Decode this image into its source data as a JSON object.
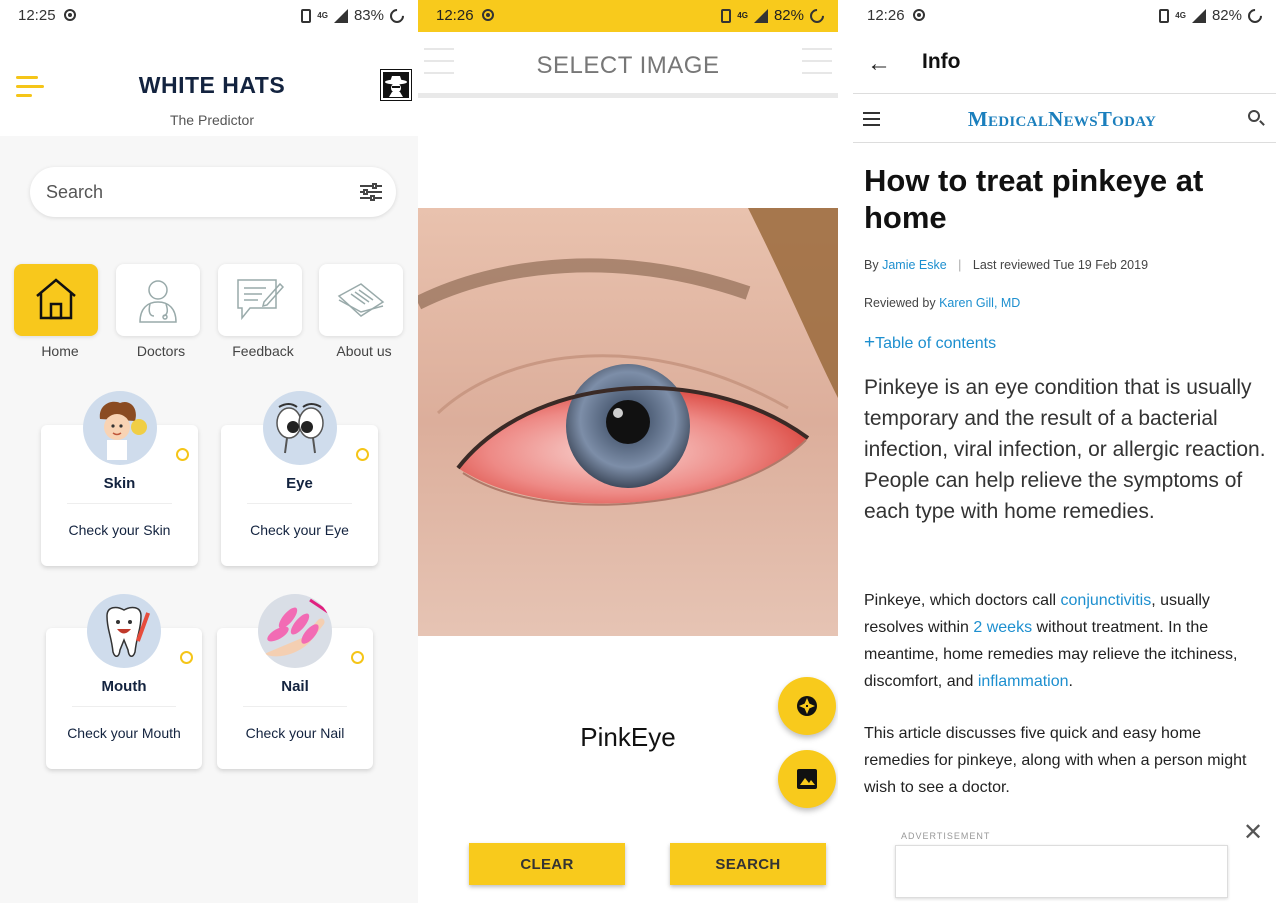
{
  "panel1": {
    "status": {
      "time": "12:25",
      "network": "4G",
      "battery": "83%"
    },
    "app_title": "WHITE HATS",
    "app_subtitle": "The Predictor",
    "search_placeholder": "Search",
    "nav": [
      {
        "label": "Home",
        "icon": "home-icon",
        "active": true
      },
      {
        "label": "Doctors",
        "icon": "doctor-icon",
        "active": false
      },
      {
        "label": "Feedback",
        "icon": "feedback-icon",
        "active": false
      },
      {
        "label": "About us",
        "icon": "about-icon",
        "active": false
      }
    ],
    "cards": [
      {
        "title": "Skin",
        "subtitle": "Check your Skin",
        "icon": "skin-avatar-icon"
      },
      {
        "title": "Eye",
        "subtitle": "Check your Eye",
        "icon": "eye-avatar-icon"
      },
      {
        "title": "Mouth",
        "subtitle": "Check your Mouth",
        "icon": "tooth-avatar-icon"
      },
      {
        "title": "Nail",
        "subtitle": "Check your Nail",
        "icon": "nail-avatar-icon"
      }
    ],
    "accent_color": "#f8c81c",
    "title_color": "#13233f"
  },
  "panel2": {
    "status": {
      "time": "12:26",
      "network": "4G",
      "battery": "82%"
    },
    "title": "SELECT IMAGE",
    "result": "PinkEye",
    "clear_label": "CLEAR",
    "search_label": "SEARCH",
    "fab_camera_icon": "camera-aperture-icon",
    "fab_gallery_icon": "image-gallery-icon"
  },
  "panel3": {
    "status": {
      "time": "12:26",
      "network": "4G",
      "battery": "82%"
    },
    "title": "Info",
    "site_logo": "MedicalNewsToday",
    "headline": "How to treat pinkeye at home",
    "byline_prefix": "By",
    "author": "Jamie Eske",
    "last_reviewed": "Last reviewed Tue 19 Feb 2019",
    "reviewed_prefix": "Reviewed by",
    "reviewer": "Karen Gill, MD",
    "toc": "Table of contents",
    "lead": "Pinkeye is an eye condition that is usually temporary and the result of a bacterial infection, viral infection, or allergic reaction. People can help relieve the symptoms of each type with home remedies.",
    "p1": {
      "a": "Pinkeye, which doctors call ",
      "link1": "conjunctivitis",
      "b": ", usually resolves within ",
      "link2": "2 weeks",
      "c": " without treatment. In the meantime, home remedies may relieve the itchiness, discomfort, and ",
      "link3": "inflammation",
      "d": "."
    },
    "p2": "This article discusses five quick and easy home remedies for pinkeye, along with when a person might wish to see a doctor.",
    "ad_label": "ADVERTISEMENT",
    "link_color": "#1d8fcf"
  }
}
